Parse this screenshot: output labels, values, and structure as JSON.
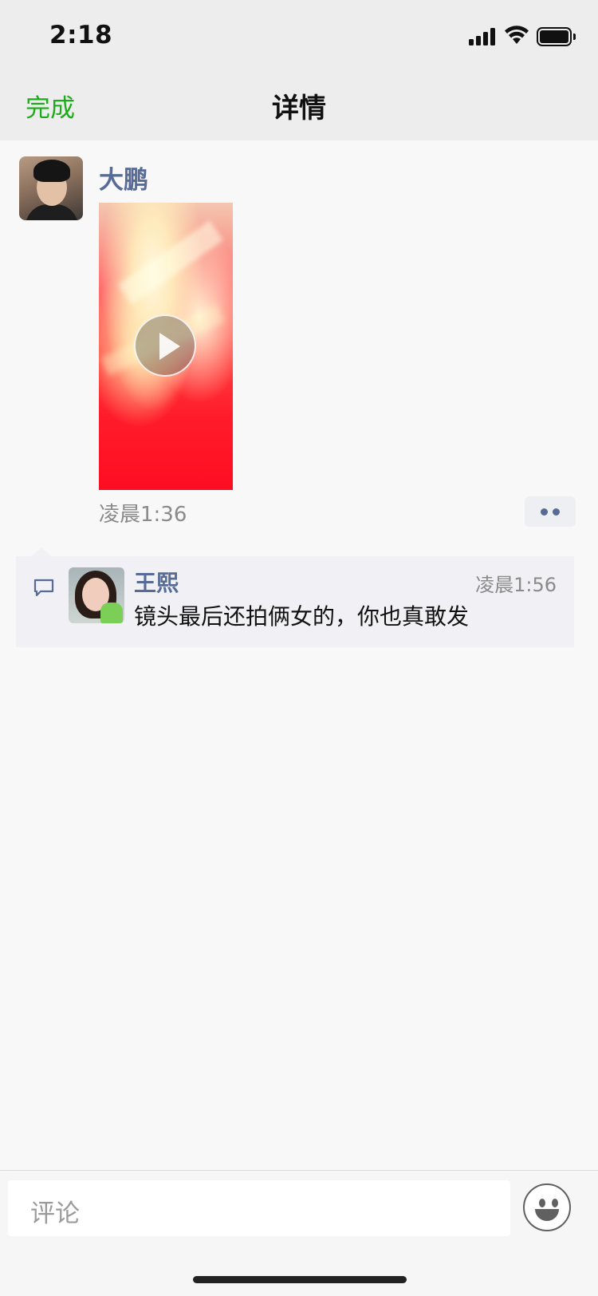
{
  "status_bar": {
    "time": "2:18"
  },
  "nav": {
    "done_label": "完成",
    "title": "详情"
  },
  "post": {
    "author": "大鹏",
    "time": "凌晨1:36",
    "media_type": "video"
  },
  "comments": [
    {
      "author": "王熙",
      "time": "凌晨1:56",
      "text": "镜头最后还拍俩女的，你也真敢发"
    }
  ],
  "input": {
    "placeholder": "评论"
  },
  "colors": {
    "accent_green": "#1aad19",
    "link_blue": "#576b95"
  }
}
